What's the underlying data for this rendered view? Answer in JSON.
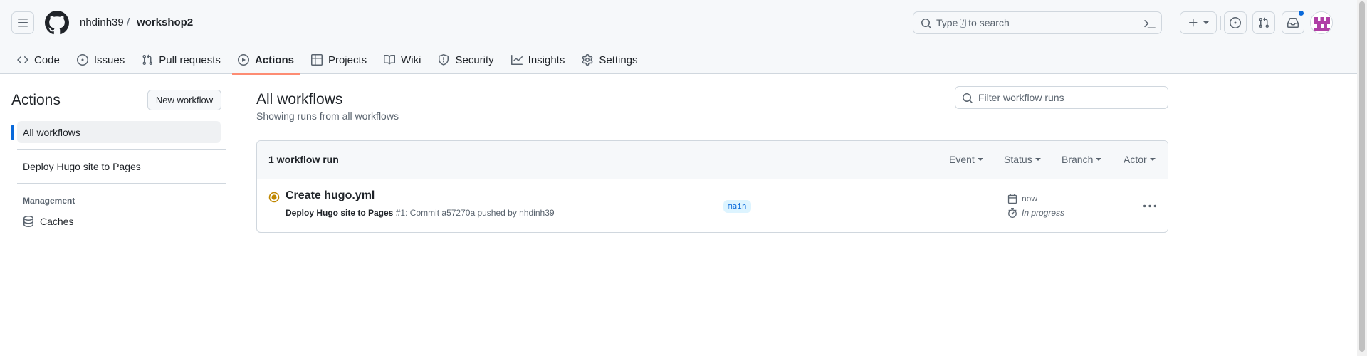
{
  "header": {
    "owner": "nhdinh39",
    "separator": "/",
    "repo": "workshop2",
    "search": {
      "prefix": "Type",
      "key": "/",
      "suffix": "to search"
    }
  },
  "tabs": [
    {
      "label": "Code",
      "icon": "code-icon"
    },
    {
      "label": "Issues",
      "icon": "issue-opened-icon"
    },
    {
      "label": "Pull requests",
      "icon": "git-pull-request-icon"
    },
    {
      "label": "Actions",
      "icon": "play-icon",
      "active": true
    },
    {
      "label": "Projects",
      "icon": "table-icon"
    },
    {
      "label": "Wiki",
      "icon": "book-icon"
    },
    {
      "label": "Security",
      "icon": "shield-icon"
    },
    {
      "label": "Insights",
      "icon": "graph-icon"
    },
    {
      "label": "Settings",
      "icon": "gear-icon"
    }
  ],
  "sidebar": {
    "title": "Actions",
    "new_workflow": "New workflow",
    "items": [
      {
        "label": "All workflows",
        "active": true
      },
      {
        "label": "Deploy Hugo site to Pages"
      }
    ],
    "management_heading": "Management",
    "caches": "Caches"
  },
  "main": {
    "title": "All workflows",
    "subtitle": "Showing runs from all workflows",
    "filter_placeholder": "Filter workflow runs",
    "runs_count": "1 workflow run",
    "filters": [
      "Event",
      "Status",
      "Branch",
      "Actor"
    ],
    "runs": [
      {
        "title": "Create hugo.yml",
        "workflow": "Deploy Hugo site to Pages",
        "run_number": "#1",
        "detail": ": Commit a57270a pushed by nhdinh39",
        "branch": "main",
        "when": "now",
        "status": "In progress"
      }
    ]
  },
  "colors": {
    "accent": "#0969da",
    "tab_underline": "#fd8c73",
    "in_progress": "#bf8700"
  }
}
